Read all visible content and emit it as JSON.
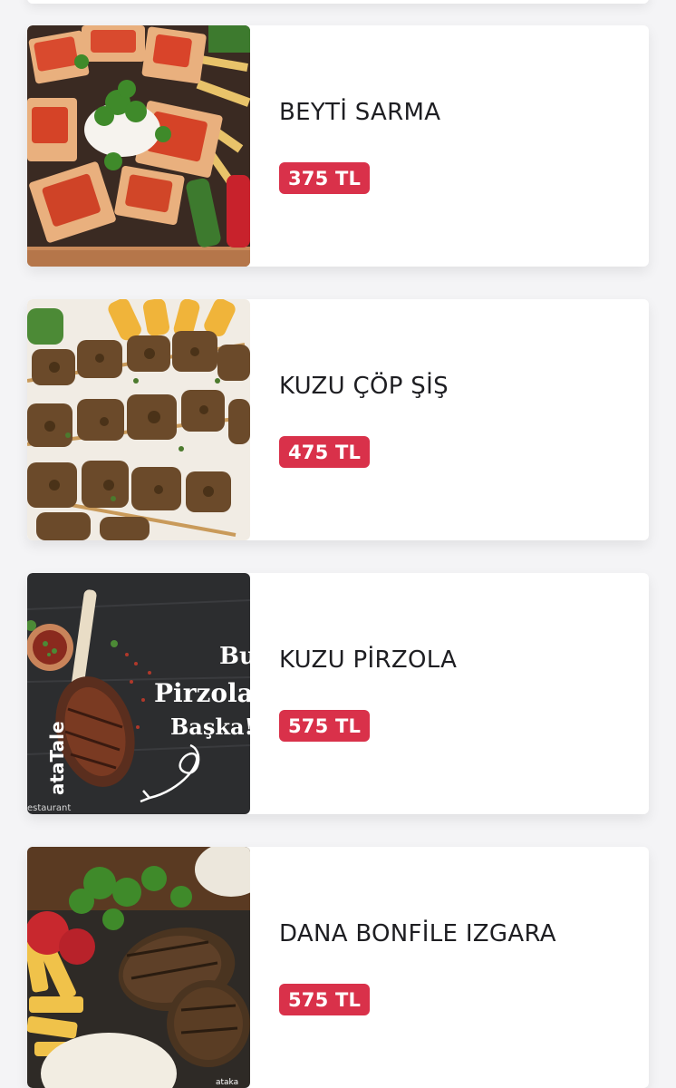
{
  "colors": {
    "background": "#f4f4f6",
    "card": "#ffffff",
    "price_badge": "#d9314a",
    "item_text": "#1e1e22"
  },
  "menu_items": [
    {
      "name": "BEYTİ SARMA",
      "price": "375 TL",
      "photo_icon": "beyti-sarma-photo"
    },
    {
      "name": "KUZU ÇÖP ŞİŞ",
      "price": "475 TL",
      "photo_icon": "kuzu-cop-sis-photo"
    },
    {
      "name": "KUZU PİRZOLA",
      "price": "575 TL",
      "photo_icon": "kuzu-pirzola-photo",
      "photo_text": {
        "line1": "Bu",
        "line2": "Pirzola",
        "line3": "Başka!",
        "side_brand": "ataTale",
        "side_sub": "estaurant"
      }
    },
    {
      "name": "DANA BONFİLE IZGARA",
      "price": "575 TL",
      "photo_icon": "dana-bonfile-photo",
      "photo_text": {
        "social": "ataka"
      }
    }
  ]
}
